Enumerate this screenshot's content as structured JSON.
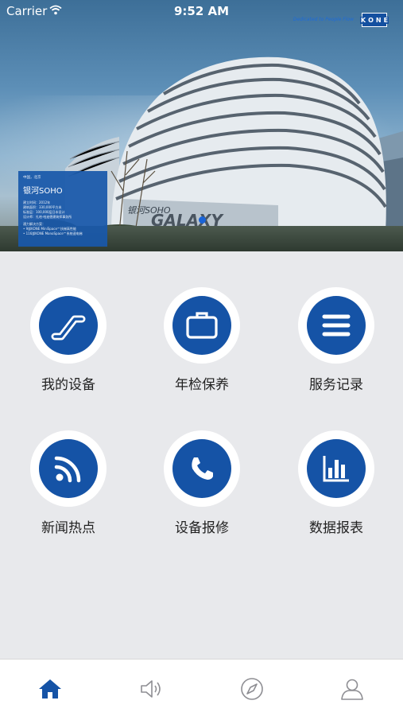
{
  "status_bar": {
    "carrier": "Carrier",
    "time": "9:52 AM"
  },
  "branding": {
    "dedicated_text": "Dedicated to People Flow",
    "logo_letters": [
      "K",
      "O",
      "N",
      "E"
    ]
  },
  "info_card": {
    "location": "中国，北京",
    "title": "银河SOHO",
    "details": [
      "建立时间：2012年",
      "建筑面积：330,000平方米",
      "标准层：100,000层日本设计",
      "设计师：扎哈·哈迪德建筑师事务所"
    ],
    "solution_heading": "通力解决方案：",
    "solutions": [
      "• 9部KONE MiniSpace™扶梯高性能",
      "• 116部KONE MonoSpace™系统速电梯"
    ]
  },
  "menu": [
    {
      "label": "我的设备",
      "icon": "escalator-icon"
    },
    {
      "label": "年检保养",
      "icon": "briefcase-icon"
    },
    {
      "label": "服务记录",
      "icon": "list-icon"
    },
    {
      "label": "新闻热点",
      "icon": "rss-icon"
    },
    {
      "label": "设备报修",
      "icon": "phone-icon"
    },
    {
      "label": "数据报表",
      "icon": "bar-chart-icon"
    }
  ],
  "tabbar": [
    {
      "icon": "home-icon",
      "active": true
    },
    {
      "icon": "speaker-icon",
      "active": false
    },
    {
      "icon": "compass-icon",
      "active": false
    },
    {
      "icon": "user-icon",
      "active": false
    }
  ],
  "colors": {
    "accent": "#1553a6",
    "background": "#e8e9ec",
    "inactive_icon": "#8e8e93"
  }
}
